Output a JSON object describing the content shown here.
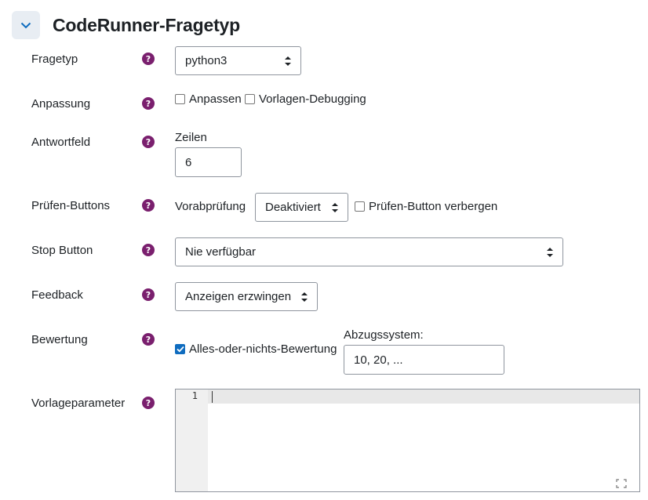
{
  "section": {
    "title": "CodeRunner-Fragetyp"
  },
  "help_glyph": "?",
  "rows": {
    "fragetyp": {
      "label": "Fragetyp",
      "value": "python3"
    },
    "anpassung": {
      "label": "Anpassung",
      "opt1": "Anpassen",
      "opt2": "Vorlagen-Debugging"
    },
    "antwortfeld": {
      "label": "Antwortfeld",
      "zeilen_label": "Zeilen",
      "zeilen_value": "6"
    },
    "pruefen": {
      "label": "Prüfen-Buttons",
      "vorab_label": "Vorabprüfung",
      "vorab_value": "Deaktiviert",
      "hide_label": "Prüfen-Button verbergen"
    },
    "stop": {
      "label": "Stop Button",
      "value": "Nie verfügbar"
    },
    "feedback": {
      "label": "Feedback",
      "value": "Anzeigen erzwingen"
    },
    "bewertung": {
      "label": "Bewertung",
      "all_or_nothing": "Alles-oder-nichts-Bewertung",
      "all_or_nothing_checked": true,
      "penalty_label": "Abzugssystem:",
      "penalty_value": "10, 20, ..."
    },
    "vorlage": {
      "label": "Vorlageparameter",
      "line_number": "1"
    }
  },
  "colors": {
    "help_bg": "#7a1f6e",
    "collapse_bg": "#e8edf3",
    "checkbox_checked": "#0f6cbf"
  }
}
